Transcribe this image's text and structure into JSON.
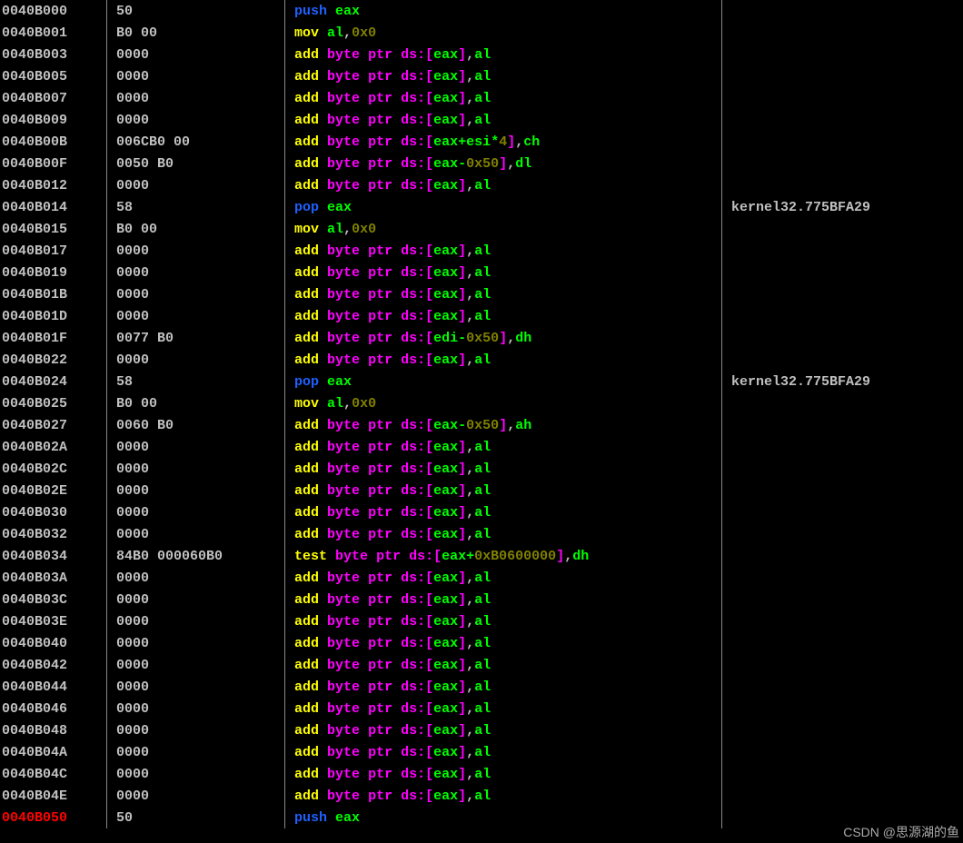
{
  "watermark": "CSDN @思源湖的鱼",
  "rows": [
    {
      "addr": "0040B000",
      "bytes": "50",
      "asm": [
        [
          "push",
          "push"
        ],
        [
          " "
        ],
        [
          "reg",
          "eax"
        ]
      ],
      "cmt": ""
    },
    {
      "addr": "0040B001",
      "bytes": "B0 00",
      "asm": [
        [
          "mov",
          "mov"
        ],
        [
          " "
        ],
        [
          "reg",
          "al"
        ],
        [
          ","
        ],
        [
          "num",
          "0x0"
        ]
      ],
      "cmt": ""
    },
    {
      "addr": "0040B003",
      "bytes": "0000",
      "asm": "add_eax_al",
      "cmt": ""
    },
    {
      "addr": "0040B005",
      "bytes": "0000",
      "asm": "add_eax_al",
      "cmt": ""
    },
    {
      "addr": "0040B007",
      "bytes": "0000",
      "asm": "add_eax_al",
      "cmt": ""
    },
    {
      "addr": "0040B009",
      "bytes": "0000",
      "asm": "add_eax_al",
      "cmt": ""
    },
    {
      "addr": "0040B00B",
      "bytes": "006CB0 00",
      "asm": [
        [
          "add",
          "add"
        ],
        [
          " "
        ],
        [
          "token",
          "byte"
        ],
        [
          " "
        ],
        [
          "token",
          "ptr"
        ],
        [
          " "
        ],
        [
          "token",
          "ds"
        ],
        [
          ":"
        ],
        [
          "brack",
          "["
        ],
        [
          "reg",
          "eax"
        ],
        [
          "reg",
          "+"
        ],
        [
          "reg",
          "esi"
        ],
        [
          "reg",
          "*"
        ],
        [
          "num",
          "4"
        ],
        [
          "brack",
          "]"
        ],
        [
          ","
        ],
        [
          "reg",
          "ch"
        ]
      ],
      "cmt": ""
    },
    {
      "addr": "0040B00F",
      "bytes": "0050 B0",
      "asm": [
        [
          "add",
          "add"
        ],
        [
          " "
        ],
        [
          "token",
          "byte"
        ],
        [
          " "
        ],
        [
          "token",
          "ptr"
        ],
        [
          " "
        ],
        [
          "token",
          "ds"
        ],
        [
          ":"
        ],
        [
          "brack",
          "["
        ],
        [
          "reg",
          "eax"
        ],
        [
          "reg",
          "-"
        ],
        [
          "num",
          "0x50"
        ],
        [
          "brack",
          "]"
        ],
        [
          ","
        ],
        [
          "reg",
          "dl"
        ]
      ],
      "cmt": ""
    },
    {
      "addr": "0040B012",
      "bytes": "0000",
      "asm": "add_eax_al",
      "cmt": ""
    },
    {
      "addr": "0040B014",
      "bytes": "58",
      "asm": [
        [
          "pop",
          "pop"
        ],
        [
          " "
        ],
        [
          "reg",
          "eax"
        ]
      ],
      "cmt": "kernel32.775BFA29"
    },
    {
      "addr": "0040B015",
      "bytes": "B0 00",
      "asm": [
        [
          "mov",
          "mov"
        ],
        [
          " "
        ],
        [
          "reg",
          "al"
        ],
        [
          ","
        ],
        [
          "num",
          "0x0"
        ]
      ],
      "cmt": ""
    },
    {
      "addr": "0040B017",
      "bytes": "0000",
      "asm": "add_eax_al",
      "cmt": ""
    },
    {
      "addr": "0040B019",
      "bytes": "0000",
      "asm": "add_eax_al",
      "cmt": ""
    },
    {
      "addr": "0040B01B",
      "bytes": "0000",
      "asm": "add_eax_al",
      "cmt": ""
    },
    {
      "addr": "0040B01D",
      "bytes": "0000",
      "asm": "add_eax_al",
      "cmt": ""
    },
    {
      "addr": "0040B01F",
      "bytes": "0077 B0",
      "asm": [
        [
          "add",
          "add"
        ],
        [
          " "
        ],
        [
          "token",
          "byte"
        ],
        [
          " "
        ],
        [
          "token",
          "ptr"
        ],
        [
          " "
        ],
        [
          "token",
          "ds"
        ],
        [
          ":"
        ],
        [
          "brack",
          "["
        ],
        [
          "reg",
          "edi"
        ],
        [
          "reg",
          "-"
        ],
        [
          "num",
          "0x50"
        ],
        [
          "brack",
          "]"
        ],
        [
          ","
        ],
        [
          "reg",
          "dh"
        ]
      ],
      "cmt": ""
    },
    {
      "addr": "0040B022",
      "bytes": "0000",
      "asm": "add_eax_al",
      "cmt": ""
    },
    {
      "addr": "0040B024",
      "bytes": "58",
      "asm": [
        [
          "pop",
          "pop"
        ],
        [
          " "
        ],
        [
          "reg",
          "eax"
        ]
      ],
      "cmt": "kernel32.775BFA29"
    },
    {
      "addr": "0040B025",
      "bytes": "B0 00",
      "asm": [
        [
          "mov",
          "mov"
        ],
        [
          " "
        ],
        [
          "reg",
          "al"
        ],
        [
          ","
        ],
        [
          "num",
          "0x0"
        ]
      ],
      "cmt": ""
    },
    {
      "addr": "0040B027",
      "bytes": "0060 B0",
      "asm": [
        [
          "add",
          "add"
        ],
        [
          " "
        ],
        [
          "token",
          "byte"
        ],
        [
          " "
        ],
        [
          "token",
          "ptr"
        ],
        [
          " "
        ],
        [
          "token",
          "ds"
        ],
        [
          ":"
        ],
        [
          "brack",
          "["
        ],
        [
          "reg",
          "eax"
        ],
        [
          "reg",
          "-"
        ],
        [
          "num",
          "0x50"
        ],
        [
          "brack",
          "]"
        ],
        [
          ","
        ],
        [
          "reg",
          "ah"
        ]
      ],
      "cmt": ""
    },
    {
      "addr": "0040B02A",
      "bytes": "0000",
      "asm": "add_eax_al",
      "cmt": ""
    },
    {
      "addr": "0040B02C",
      "bytes": "0000",
      "asm": "add_eax_al",
      "cmt": ""
    },
    {
      "addr": "0040B02E",
      "bytes": "0000",
      "asm": "add_eax_al",
      "cmt": ""
    },
    {
      "addr": "0040B030",
      "bytes": "0000",
      "asm": "add_eax_al",
      "cmt": ""
    },
    {
      "addr": "0040B032",
      "bytes": "0000",
      "asm": "add_eax_al",
      "cmt": ""
    },
    {
      "addr": "0040B034",
      "bytes": "84B0 000060B0",
      "asm": [
        [
          "test",
          "test"
        ],
        [
          " "
        ],
        [
          "token",
          "byte"
        ],
        [
          " "
        ],
        [
          "token",
          "ptr"
        ],
        [
          " "
        ],
        [
          "token",
          "ds"
        ],
        [
          ":"
        ],
        [
          "brack",
          "["
        ],
        [
          "reg",
          "eax"
        ],
        [
          "reg",
          "+"
        ],
        [
          "num",
          "0xB0600000"
        ],
        [
          "brack",
          "]"
        ],
        [
          ","
        ],
        [
          "reg",
          "dh"
        ]
      ],
      "cmt": ""
    },
    {
      "addr": "0040B03A",
      "bytes": "0000",
      "asm": "add_eax_al",
      "cmt": ""
    },
    {
      "addr": "0040B03C",
      "bytes": "0000",
      "asm": "add_eax_al",
      "cmt": ""
    },
    {
      "addr": "0040B03E",
      "bytes": "0000",
      "asm": "add_eax_al",
      "cmt": ""
    },
    {
      "addr": "0040B040",
      "bytes": "0000",
      "asm": "add_eax_al",
      "cmt": ""
    },
    {
      "addr": "0040B042",
      "bytes": "0000",
      "asm": "add_eax_al",
      "cmt": ""
    },
    {
      "addr": "0040B044",
      "bytes": "0000",
      "asm": "add_eax_al",
      "cmt": ""
    },
    {
      "addr": "0040B046",
      "bytes": "0000",
      "asm": "add_eax_al",
      "cmt": ""
    },
    {
      "addr": "0040B048",
      "bytes": "0000",
      "asm": "add_eax_al",
      "cmt": ""
    },
    {
      "addr": "0040B04A",
      "bytes": "0000",
      "asm": "add_eax_al",
      "cmt": ""
    },
    {
      "addr": "0040B04C",
      "bytes": "0000",
      "asm": "add_eax_al",
      "cmt": ""
    },
    {
      "addr": "0040B04E",
      "bytes": "0000",
      "asm": "add_eax_al",
      "cmt": ""
    },
    {
      "addr": "0040B050",
      "addrClass": "addr-red",
      "bytes": "50",
      "asm": [
        [
          "push",
          "push"
        ],
        [
          " "
        ],
        [
          "reg",
          "eax"
        ]
      ],
      "cmt": ""
    }
  ],
  "patterns": {
    "add_eax_al": [
      [
        "add",
        "add"
      ],
      [
        " "
      ],
      [
        "token",
        "byte"
      ],
      [
        " "
      ],
      [
        "token",
        "ptr"
      ],
      [
        " "
      ],
      [
        "token",
        "ds"
      ],
      [
        ":"
      ],
      [
        "brack",
        "["
      ],
      [
        "reg",
        "eax"
      ],
      [
        "brack",
        "]"
      ],
      [
        ","
      ],
      [
        "reg",
        "al"
      ]
    ]
  }
}
